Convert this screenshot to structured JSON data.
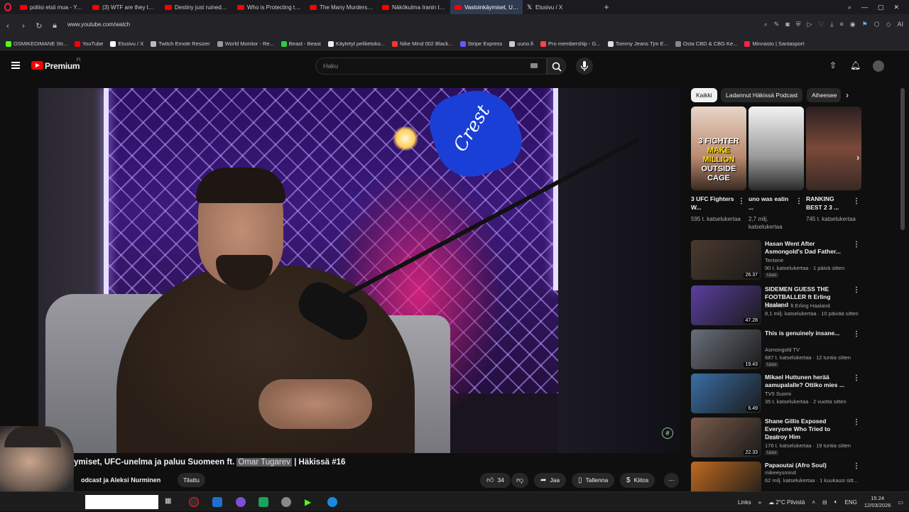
{
  "browser": {
    "tabs": [
      {
        "label": "poliisi etsii mua - YouTube",
        "icon": "youtube-icon"
      },
      {
        "label": "(3) WTF are they thinking",
        "icon": "youtube-icon"
      },
      {
        "label": "Destiny just ruined his car",
        "icon": "youtube-icon"
      },
      {
        "label": "Who is Protecting the Jeff",
        "icon": "youtube-icon"
      },
      {
        "label": "The Many Murders of Jeffr",
        "icon": "youtube-icon"
      },
      {
        "label": "Näkökulma Iranin tapahtu",
        "icon": "youtube-icon"
      },
      {
        "label": "Vastoinkäymiset, UFC",
        "icon": "youtube-icon",
        "active": true
      },
      {
        "label": "Etusivu / X",
        "icon": "x-icon"
      }
    ],
    "url": "www.youtube.com/watch",
    "bookmarks": [
      {
        "label": "OSMIKEDIMANE Str...",
        "color": "#53fc18"
      },
      {
        "label": "YouTube",
        "color": "#ff0000"
      },
      {
        "label": "Etusivu / X",
        "color": "#ffffff"
      },
      {
        "label": "Twitch Emote Resizer",
        "color": "#bbbbbb"
      },
      {
        "label": "World Monitor - Re...",
        "color": "#999999"
      },
      {
        "label": "Beast - Beast",
        "color": "#2ecc40"
      },
      {
        "label": "Käytetyt pelitietoko...",
        "color": "#eeeeee"
      },
      {
        "label": "Nike Mind 002 Black...",
        "color": "#ff3333"
      },
      {
        "label": "Stripe Express",
        "color": "#635bff"
      },
      {
        "label": "uuno.fi",
        "color": "#cccccc"
      },
      {
        "label": "Pro membership - G...",
        "color": "#ff4444"
      },
      {
        "label": "Tommy Jeans Tjm E...",
        "color": "#dddddd"
      },
      {
        "label": "Osta CBD & CBG Ke...",
        "color": "#888888"
      },
      {
        "label": "Minnasto | Santasport",
        "color": "#ff2244"
      }
    ]
  },
  "youtube": {
    "logo_text": "Premium",
    "country_code": "FI",
    "search_placeholder": "Haku",
    "video": {
      "title_prefix": "ymiset, UFC-unelma ja paluu Suomeen ft. ",
      "title_highlight": "Omar Tugarev",
      "title_suffix": " | Häkissä #16",
      "channel": "odcast ja Aleksi Nurminen",
      "subscribe_label": "Tilattu",
      "likes": "34",
      "share_label": "Jaa",
      "save_label": "Tallenna",
      "thanks_label": "Kiitos",
      "glove_text": "Crest"
    },
    "chips": [
      {
        "label": "Kaikki",
        "active": true
      },
      {
        "label": "Ladannut Häkissä Podcast",
        "active": false
      },
      {
        "label": "Aiheesee",
        "active": false
      }
    ],
    "shorts": [
      {
        "title": "3 UFC Fighters W...",
        "views": "595 t. katselukertaa",
        "caption_top": "3 FIGHTER",
        "caption_mid": "MAKE MILLION",
        "caption_bot": "OUTSIDE CAGE"
      },
      {
        "title": "uno was eatin ...",
        "views": "2,7 milj. katselukertaa"
      },
      {
        "title": "RANKING BEST 2 3 ...",
        "views": "745 t. katselukertaa"
      }
    ],
    "recommendations": [
      {
        "title": "Hasan Went After Asmongold's Dad Father...",
        "channel": "Tectone",
        "views": "90 t. katselukertaa · 1 päivä sitten",
        "duration": "26.37",
        "badge": "Uusi",
        "thumb": "#4a3a2e"
      },
      {
        "title": "SIDEMEN GUESS THE FOOTBALLER ft Erling Haaland",
        "channel": "Sidemen · ft Erling Haaland",
        "views": "8,1 milj. katselukertaa · 10 päivää sitten",
        "duration": "47.28",
        "badge": "",
        "thumb": "#5b3fa0"
      },
      {
        "title": "This is genuinely insane...",
        "channel": "Asmongold TV",
        "views": "687 t. katselukertaa · 12 tuntia sitten",
        "duration": "19.43",
        "badge": "Uusi",
        "thumb": "#6a6f7a"
      },
      {
        "title": "Mikael Huttunen herää aamupalalle? Ottiko mies ...",
        "channel": "TV5 Suomi",
        "views": "35 t. katselukertaa · 2 vuotta sitten",
        "duration": "6.49",
        "badge": "",
        "thumb": "#3a6ea5"
      },
      {
        "title": "Shane Gillis Exposed Everyone Who Tried to Destroy Him",
        "channel": "Moon",
        "views": "176 t. katselukertaa · 19 tuntia sitten",
        "duration": "22.33",
        "badge": "Uusi",
        "thumb": "#7a5a4a"
      },
      {
        "title": "Papaoutai (Afro Soul)",
        "channel": "mikeeysmind",
        "views": "62 milj. katselukertaa · 1 kuukausi sitt...",
        "duration": "",
        "badge": "",
        "thumb": "#c06a20"
      }
    ]
  },
  "taskbar": {
    "links_label": "Links",
    "weather": "2°C Pilvistä",
    "language": "ENG",
    "time": "15.24",
    "date": "12/03/2026"
  }
}
